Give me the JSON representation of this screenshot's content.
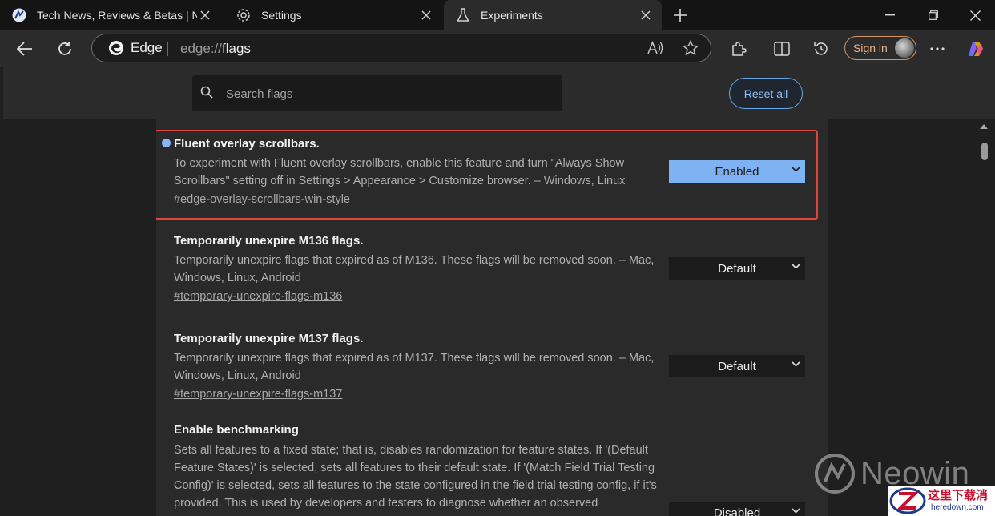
{
  "tabs": [
    {
      "title": "Tech News, Reviews & Betas | Neowin",
      "icon": "neowin-favicon",
      "active": false
    },
    {
      "title": "Settings",
      "icon": "gear-icon",
      "active": false
    },
    {
      "title": "Experiments",
      "icon": "flask-icon",
      "active": true
    }
  ],
  "omnibox": {
    "brand": "Edge",
    "url_prefix": "edge://",
    "url_path": "flags"
  },
  "toolbar": {
    "signin_label": "Sign in"
  },
  "flags_page": {
    "search_placeholder": "Search flags",
    "reset_all_label": "Reset all",
    "flags": [
      {
        "title": "Fluent overlay scrollbars.",
        "description": "To experiment with Fluent overlay scrollbars, enable this feature and turn \"Always Show Scrollbars\" setting off in Settings > Appearance > Customize browser. – Windows, Linux",
        "anchor": "#edge-overlay-scrollbars-win-style",
        "state": "Enabled",
        "modified": true,
        "highlighted": true
      },
      {
        "title": "Temporarily unexpire M136 flags.",
        "description": "Temporarily unexpire flags that expired as of M136. These flags will be removed soon. – Mac, Windows, Linux, Android",
        "anchor": "#temporary-unexpire-flags-m136",
        "state": "Default"
      },
      {
        "title": "Temporarily unexpire M137 flags.",
        "description": "Temporarily unexpire flags that expired as of M137. These flags will be removed soon. – Mac, Windows, Linux, Android",
        "anchor": "#temporary-unexpire-flags-m137",
        "state": "Default"
      },
      {
        "title": "Enable benchmarking",
        "description": "Sets all features to a fixed state; that is, disables randomization for feature states. If '(Default Feature States)' is selected, sets all features to their default state. If '(Match Field Trial Testing Config)' is selected, sets all features to the state configured in the field trial testing config, if it's provided. This is used by developers and testers to diagnose whether an observed",
        "state": "Disabled"
      }
    ]
  },
  "watermarks": {
    "neowin": "Neowin",
    "cn_site": "这里下载消",
    "cn_domain": "heredown.com"
  },
  "colors": {
    "accent": "#7fb2f2",
    "highlight_border": "#e0443e",
    "signin_border": "#d59361"
  }
}
